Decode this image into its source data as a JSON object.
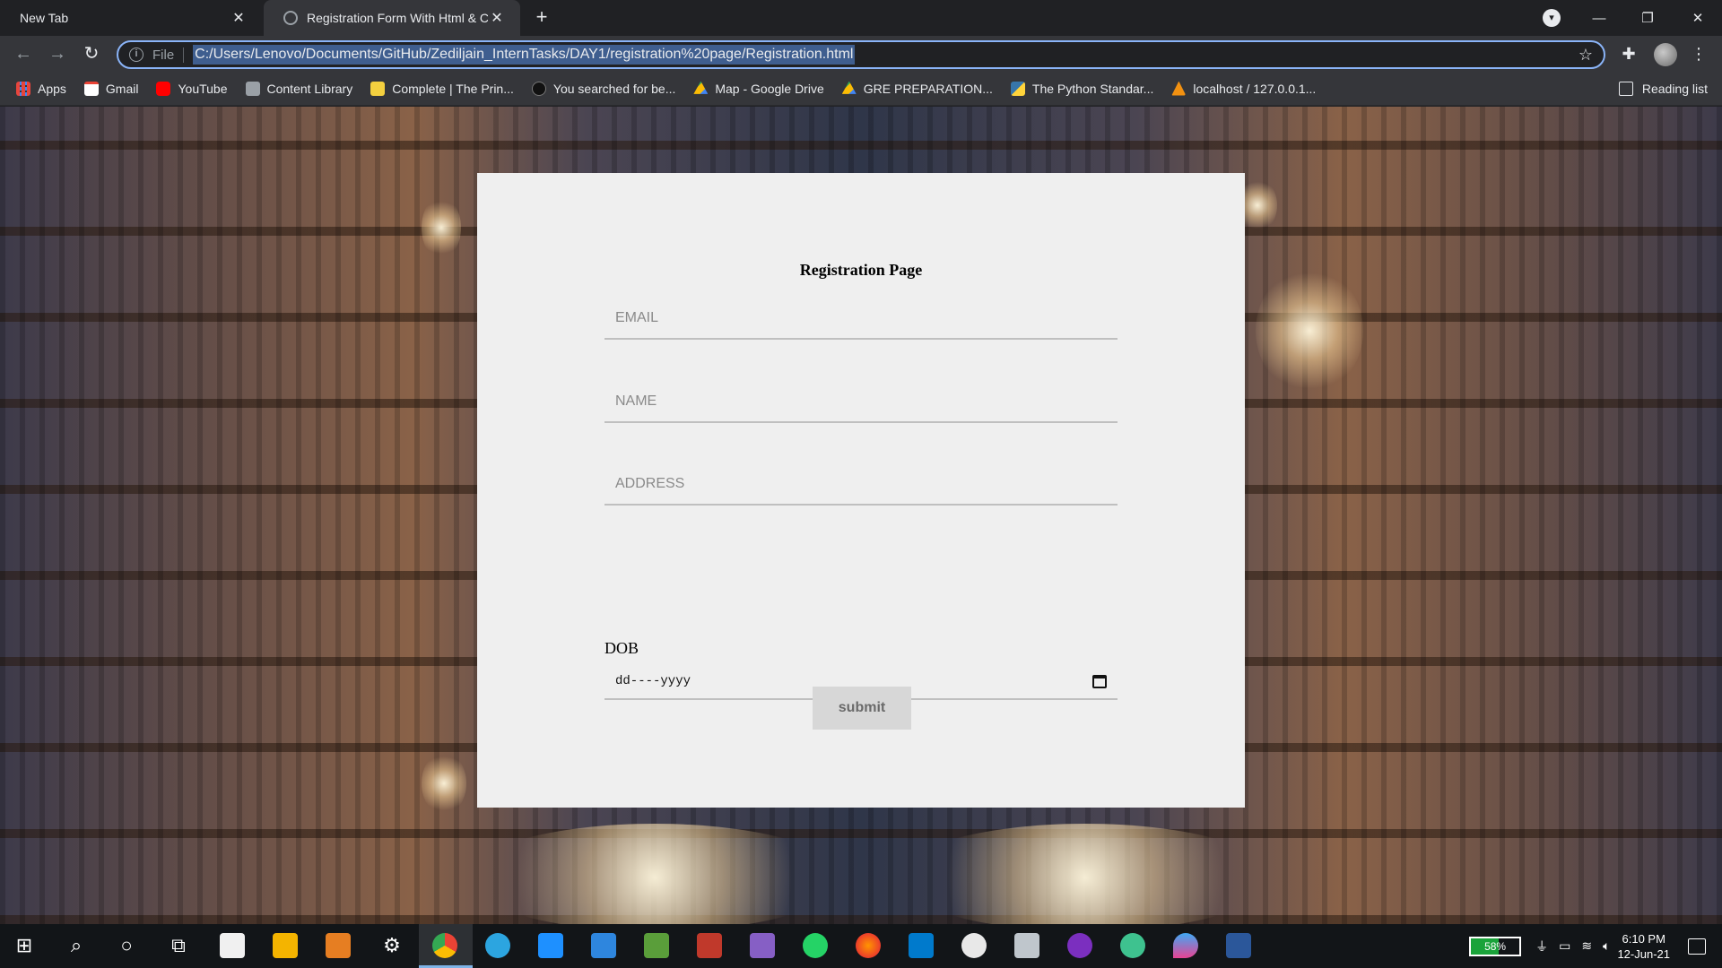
{
  "browser": {
    "tabs": [
      {
        "title": "New Tab",
        "active": false
      },
      {
        "title": "Registration Form With Html & C",
        "active": true
      }
    ],
    "address_scheme": "File",
    "url": "C:/Users/Lenovo/Documents/GitHub/Zediljain_InternTasks/DAY1/registration%20page/Registration.html",
    "bookmarks": [
      {
        "label": "Apps",
        "icon": "apps-grid-icon",
        "color": "#e8453c"
      },
      {
        "label": "Gmail",
        "icon": "gmail-icon",
        "color": "#ea4335"
      },
      {
        "label": "YouTube",
        "icon": "youtube-icon",
        "color": "#ff0000"
      },
      {
        "label": "Content Library",
        "icon": "library-icon",
        "color": "#9aa0a6"
      },
      {
        "label": "Complete | The Prin...",
        "icon": "p-icon",
        "color": "#f4d03f"
      },
      {
        "label": "You searched for be...",
        "icon": "g-icon",
        "color": "#111111"
      },
      {
        "label": "Map - Google Drive",
        "icon": "drive-icon",
        "color": "#34a853"
      },
      {
        "label": "GRE PREPARATION...",
        "icon": "drive-icon",
        "color": "#fbbc04"
      },
      {
        "label": "The Python Standar...",
        "icon": "python-icon",
        "color": "#3776ab"
      },
      {
        "label": "localhost / 127.0.0.1...",
        "icon": "phpmyadmin-icon",
        "color": "#f29111"
      }
    ],
    "reading_list": "Reading list"
  },
  "form": {
    "title": "Registration Page",
    "email_placeholder": "EMAIL",
    "name_placeholder": "NAME",
    "address_placeholder": "ADDRESS",
    "dob_label": "DOB",
    "dob_placeholder": "dd----yyyy",
    "submit_label": "submit"
  },
  "taskbar": {
    "battery_percent": "58%",
    "battery_level": 0.58,
    "time": "6:10 PM",
    "date": "12-Jun-21"
  }
}
